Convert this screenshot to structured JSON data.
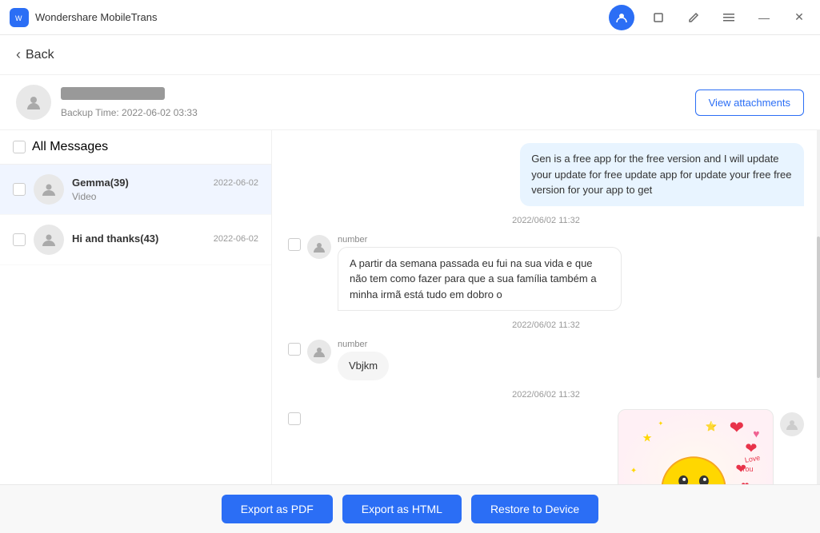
{
  "app": {
    "title": "Wondershare MobileTrans"
  },
  "header": {
    "back_label": "Back",
    "profile_name_masked": "████████████",
    "backup_time_label": "Backup Time: 2022-06-02 03:33",
    "view_attachments_label": "View attachments"
  },
  "left_panel": {
    "all_messages_label": "All Messages",
    "conversations": [
      {
        "name": "Gemma(39)",
        "date": "2022-06-02",
        "preview": "Video",
        "active": true
      },
      {
        "name": "Hi and thanks(43)",
        "date": "2022-06-02",
        "preview": "",
        "active": false
      }
    ]
  },
  "messages": [
    {
      "type": "outgoing",
      "timestamp": null,
      "text": "Gen is a free app for the free version and I will update your update for free update app for update your free free version for your app to get",
      "sender": null
    },
    {
      "type": "timestamp",
      "value": "2022/06/02 11:32"
    },
    {
      "type": "incoming",
      "sender": "number",
      "text": "A partir da semana passada eu fui na sua vida e que não tem como fazer para que a sua família também a minha irmã está tudo em dobro o"
    },
    {
      "type": "timestamp",
      "value": "2022/06/02 11:32"
    },
    {
      "type": "incoming",
      "sender": "number",
      "text": "Vbjkm"
    },
    {
      "type": "timestamp",
      "value": "2022/06/02 11:32"
    },
    {
      "type": "image",
      "sender": null
    }
  ],
  "footer": {
    "export_pdf_label": "Export as PDF",
    "export_html_label": "Export as HTML",
    "restore_device_label": "Restore to Device"
  },
  "icons": {
    "person": "👤",
    "back_arrow": "‹"
  }
}
